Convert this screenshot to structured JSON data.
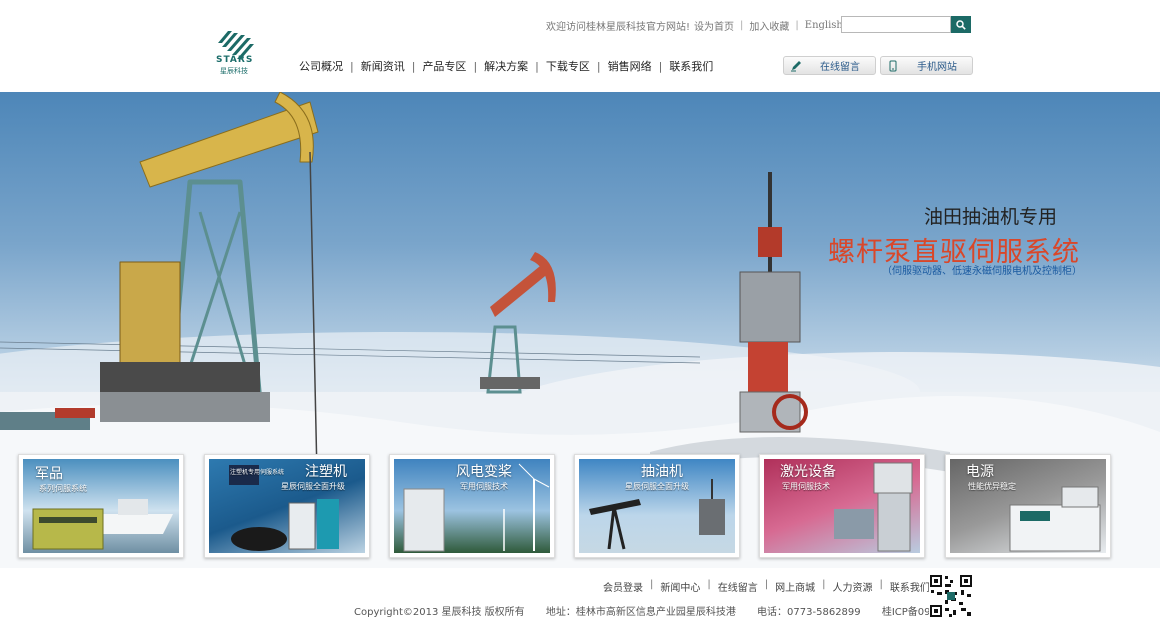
{
  "header": {
    "logo_text": "STARS",
    "logo_subtext": "星辰科技",
    "welcome": "欢迎访问桂林星辰科技官方网站!",
    "set_homepage": "设为首页",
    "add_favorite": "加入收藏",
    "english": "English",
    "search_placeholder": "",
    "nav": [
      "公司概况",
      "新闻资讯",
      "产品专区",
      "解决方案",
      "下载专区",
      "销售网络",
      "联系我们"
    ],
    "message_button": "在线留言",
    "mobile_button": "手机网站"
  },
  "banner": {
    "line1": "油田抽油机专用",
    "line2": "螺杆泵直驱伺服系统",
    "line3": "（伺服驱动器、低速永磁伺服电机及控制柜）"
  },
  "tiles": [
    {
      "title": "军品",
      "subtitle": "系列伺服系统"
    },
    {
      "title": "注塑机",
      "subtitle": "星辰伺服全面升级",
      "badge": "注塑机专用伺服系统"
    },
    {
      "title": "风电变桨",
      "subtitle": "军用伺服技术"
    },
    {
      "title": "抽油机",
      "subtitle": "星辰伺服全面升级"
    },
    {
      "title": "激光设备",
      "subtitle": "军用伺服技术"
    },
    {
      "title": "电源",
      "subtitle": "性能优异稳定"
    }
  ],
  "footer": {
    "links": [
      "会员登录",
      "新闻中心",
      "在线留言",
      "网上商城",
      "人力资源",
      "联系我们"
    ],
    "copyright": "Copyright©2013 星辰科技 版权所有",
    "address": "地址：桂林市高新区信息产业园星辰科技港",
    "phone": "电话：0773-5862899",
    "icp": "桂ICP备09096283"
  },
  "colors": {
    "brand": "#1c6a66",
    "accent_red": "#d9472a",
    "subtitle_blue": "#1a5aa0"
  }
}
